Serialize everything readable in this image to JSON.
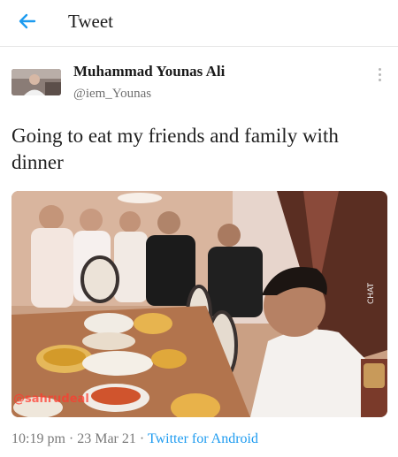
{
  "header": {
    "title": "Tweet",
    "back_icon": "arrow-left-icon",
    "accent": "#1d9bf0"
  },
  "author": {
    "name": "Muhammad Younas Ali",
    "handle": "@iem_Younas"
  },
  "tweet": {
    "text": "Going to eat my friends and family with dinner"
  },
  "photo": {
    "watermark": "@sahrudeal",
    "corner_label": "CHAT"
  },
  "meta": {
    "time": "10:19 pm",
    "separator": "·",
    "date": "23 Mar 21",
    "source": "Twitter for Android"
  }
}
